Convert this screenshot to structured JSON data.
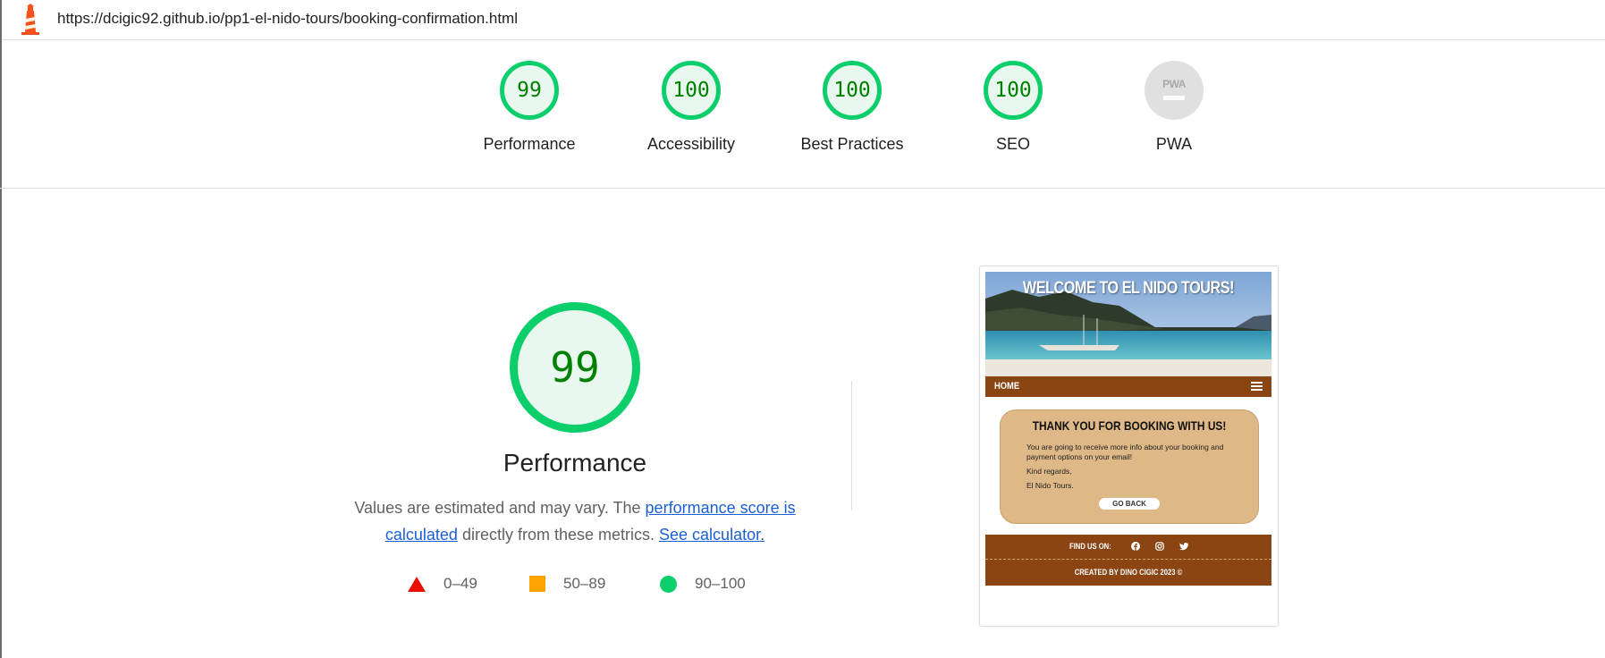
{
  "topbar": {
    "url": "https://dcigic92.github.io/pp1-el-nido-tours/booking-confirmation.html"
  },
  "gauges": [
    {
      "score": "99",
      "label": "Performance"
    },
    {
      "score": "100",
      "label": "Accessibility"
    },
    {
      "score": "100",
      "label": "Best Practices"
    },
    {
      "score": "100",
      "label": "SEO"
    },
    {
      "score": "PWA",
      "label": "PWA"
    }
  ],
  "performance": {
    "score": "99",
    "title": "Performance",
    "desc_part1": "Values are estimated and may vary. The ",
    "desc_link1": "performance score is calculated",
    "desc_part2": " directly from these metrics. ",
    "desc_link2": "See calculator."
  },
  "legend": [
    {
      "range": "0–49",
      "color": "#eb0f00",
      "shape": "triangle"
    },
    {
      "range": "50–89",
      "color": "#ffa400",
      "shape": "square"
    },
    {
      "range": "90–100",
      "color": "#0cce6b",
      "shape": "circle"
    }
  ],
  "screenshot": {
    "hero_title": "WELCOME TO EL NIDO TOURS!",
    "nav_home": "HOME",
    "card_title": "THANK YOU FOR BOOKING WITH US!",
    "card_text": "You are going to receive more info about your booking and payment options on your email!",
    "card_regards": "Kind regards,",
    "card_sign": "El Nido Tours.",
    "go_back": "GO BACK",
    "find_us": "FIND US ON:",
    "credit": "CREATED BY DINO CIGIC 2023 ©"
  },
  "colors": {
    "pass_green": "#0cce6b",
    "score_text": "#008000",
    "brown": "#8b4513",
    "card_tan": "#deb887",
    "link_blue": "#1a5fd4"
  }
}
